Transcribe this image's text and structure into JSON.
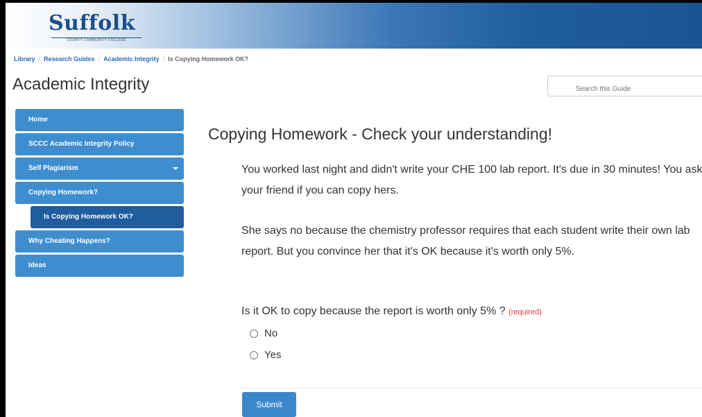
{
  "header": {
    "logo": "Suffolk",
    "logo_subtitle": "COUNTY COMMUNITY COLLEGE"
  },
  "breadcrumb": [
    "Library",
    "Research Guides",
    "Academic Integrity",
    "Is Copying Homework OK?"
  ],
  "guide_title": "Academic Integrity",
  "search": {
    "placeholder": "Search this Guide"
  },
  "nav": {
    "items": [
      {
        "label": "Home"
      },
      {
        "label": "SCCC Academic Integrity Policy"
      },
      {
        "label": "Self Plagiarism",
        "has_dropdown": true
      },
      {
        "label": "Copying Homework?"
      },
      {
        "label": "Is Copying Homework OK?",
        "sub": true,
        "active": true
      },
      {
        "label": "Why Cheating Happens?"
      },
      {
        "label": "Ideas"
      }
    ]
  },
  "content": {
    "title": "Copying Homework - Check your understanding!",
    "paragraph1": "You worked last night and didn't write your CHE 100 lab report. It's due in 30 minutes! You ask your friend if you can copy hers.",
    "paragraph2": "She says no because the chemistry professor requires that each student write their own lab report. But you convince her that it's OK because it's worth only 5%.",
    "question": "Is it OK to copy because the report is worth only 5% ?",
    "required": "(required)",
    "options": [
      "No",
      "Yes"
    ],
    "submit_label": "Submit"
  },
  "colors": {
    "nav_blue": "#3e8ecf",
    "nav_active": "#1f5d9e",
    "link_blue": "#2a6db5",
    "required_red": "#e53935"
  }
}
